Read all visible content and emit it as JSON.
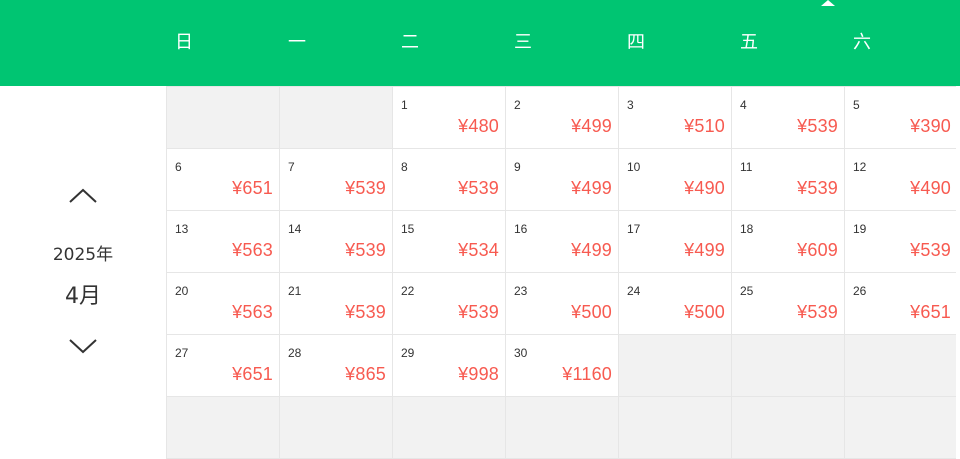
{
  "weekdays": [
    "日",
    "一",
    "二",
    "三",
    "四",
    "五",
    "六"
  ],
  "nav": {
    "year": "2025年",
    "month": "4月"
  },
  "colors": {
    "header": "#00c572",
    "price": "#f75a50",
    "empty_cell": "#f2f2f2"
  },
  "weeks": [
    [
      null,
      null,
      {
        "day": "1",
        "price": "¥480"
      },
      {
        "day": "2",
        "price": "¥499"
      },
      {
        "day": "3",
        "price": "¥510"
      },
      {
        "day": "4",
        "price": "¥539"
      },
      {
        "day": "5",
        "price": "¥390"
      }
    ],
    [
      {
        "day": "6",
        "price": "¥651"
      },
      {
        "day": "7",
        "price": "¥539"
      },
      {
        "day": "8",
        "price": "¥539"
      },
      {
        "day": "9",
        "price": "¥499"
      },
      {
        "day": "10",
        "price": "¥490"
      },
      {
        "day": "11",
        "price": "¥539"
      },
      {
        "day": "12",
        "price": "¥490"
      }
    ],
    [
      {
        "day": "13",
        "price": "¥563"
      },
      {
        "day": "14",
        "price": "¥539"
      },
      {
        "day": "15",
        "price": "¥534"
      },
      {
        "day": "16",
        "price": "¥499"
      },
      {
        "day": "17",
        "price": "¥499"
      },
      {
        "day": "18",
        "price": "¥609"
      },
      {
        "day": "19",
        "price": "¥539"
      }
    ],
    [
      {
        "day": "20",
        "price": "¥563"
      },
      {
        "day": "21",
        "price": "¥539"
      },
      {
        "day": "22",
        "price": "¥539"
      },
      {
        "day": "23",
        "price": "¥500"
      },
      {
        "day": "24",
        "price": "¥500"
      },
      {
        "day": "25",
        "price": "¥539"
      },
      {
        "day": "26",
        "price": "¥651"
      }
    ],
    [
      {
        "day": "27",
        "price": "¥651"
      },
      {
        "day": "28",
        "price": "¥865"
      },
      {
        "day": "29",
        "price": "¥998"
      },
      {
        "day": "30",
        "price": "¥1160"
      },
      null,
      null,
      null
    ],
    [
      null,
      null,
      null,
      null,
      null,
      null,
      null
    ]
  ]
}
